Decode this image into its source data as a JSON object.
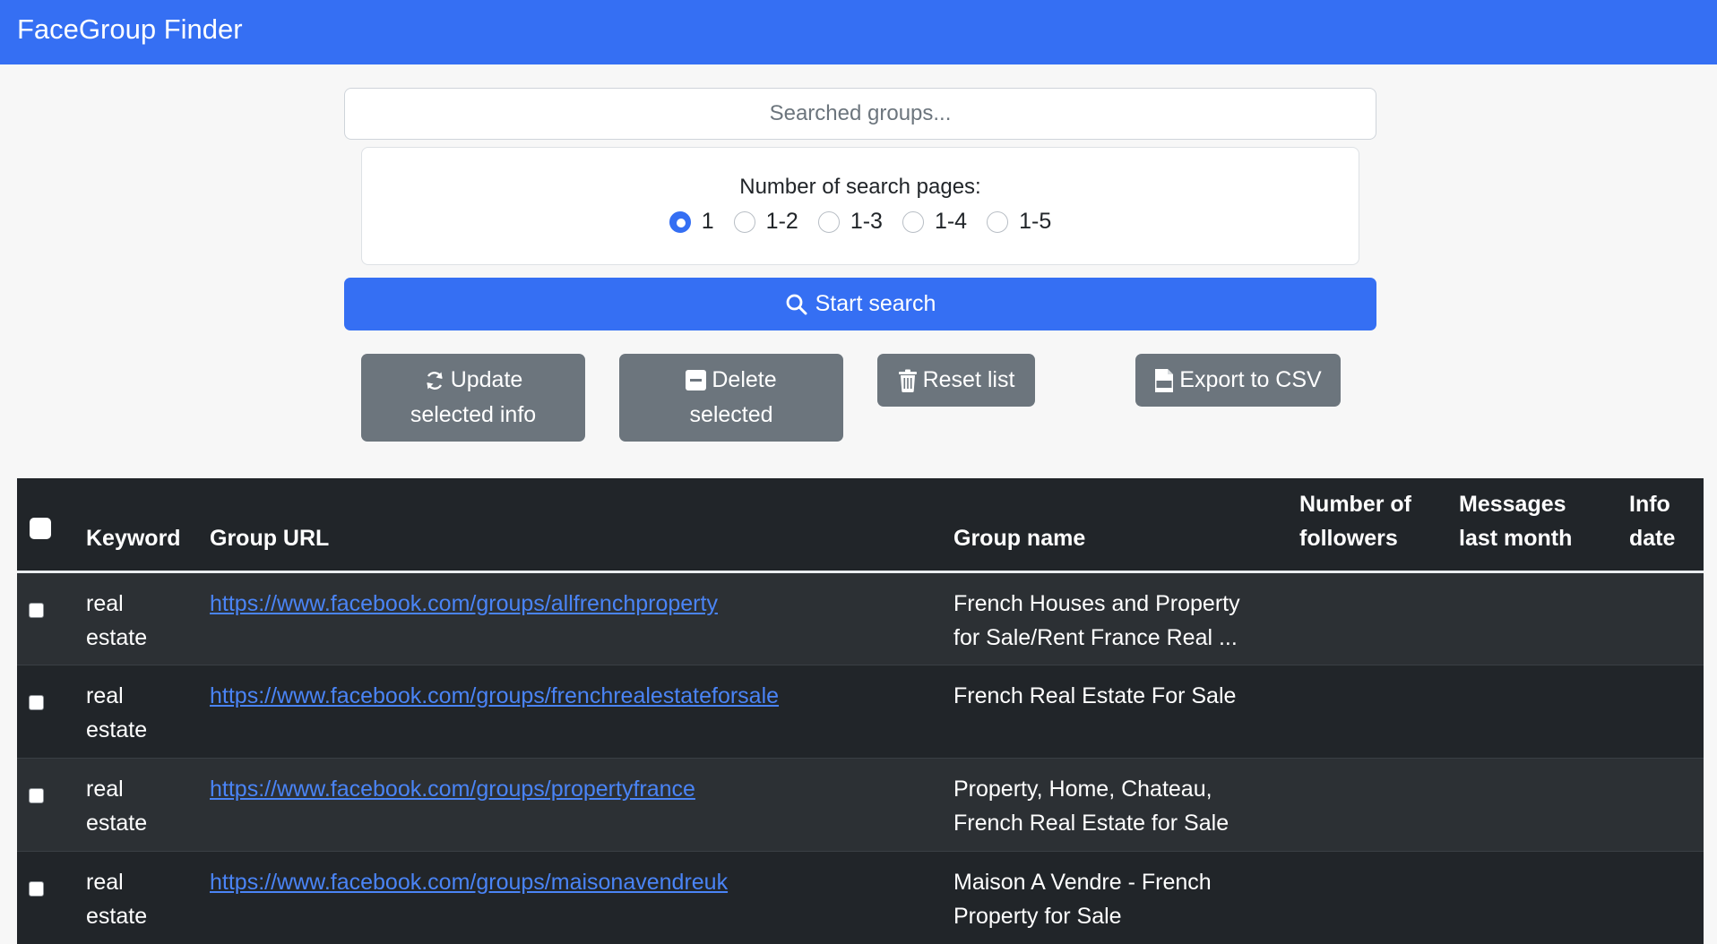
{
  "app": {
    "title": "FaceGroup Finder"
  },
  "search": {
    "placeholder": "Searched groups..."
  },
  "pages": {
    "label": "Number of search pages:",
    "options": [
      "1",
      "1-2",
      "1-3",
      "1-4",
      "1-5"
    ],
    "selected": "1"
  },
  "buttons": {
    "start": "Start search",
    "update_line1": "Update",
    "update_line2": "selected info",
    "delete_line1": "Delete",
    "delete_line2": "selected",
    "reset": "Reset list",
    "export": "Export to CSV"
  },
  "table": {
    "headers": {
      "keyword": "Keyword",
      "url": "Group URL",
      "name": "Group name",
      "followers_1": "Number of",
      "followers_2": "followers",
      "messages_1": "Messages",
      "messages_2": "last month",
      "info_1": "Info",
      "info_2": "date"
    },
    "rows": [
      {
        "keyword_1": "real",
        "keyword_2": "estate",
        "url": "https://www.facebook.com/groups/allfrenchproperty",
        "name_1": "French Houses and Property",
        "name_2": "for Sale/Rent France Real ...",
        "followers": "",
        "messages": "",
        "info_date": ""
      },
      {
        "keyword_1": "real",
        "keyword_2": "estate",
        "url": "https://www.facebook.com/groups/frenchrealestateforsale",
        "name_1": "French Real Estate For Sale",
        "name_2": "",
        "followers": "",
        "messages": "",
        "info_date": ""
      },
      {
        "keyword_1": "real",
        "keyword_2": "estate",
        "url": "https://www.facebook.com/groups/propertyfrance",
        "name_1": "Property, Home, Chateau,",
        "name_2": "French Real Estate for Sale",
        "followers": "",
        "messages": "",
        "info_date": ""
      },
      {
        "keyword_1": "real",
        "keyword_2": "estate",
        "url": "https://www.facebook.com/groups/maisonavendreuk",
        "name_1": "Maison A Vendre - French",
        "name_2": "Property for Sale",
        "followers": "",
        "messages": "",
        "info_date": ""
      }
    ]
  },
  "colors": {
    "primary": "#356ff3",
    "secondary": "#6c757d",
    "table_bg": "#212529",
    "link": "#4a84f6"
  },
  "icons": {
    "start": "search-icon",
    "update": "refresh-icon",
    "delete": "minus-square-icon",
    "reset": "trash-icon",
    "export": "csv-file-icon"
  }
}
